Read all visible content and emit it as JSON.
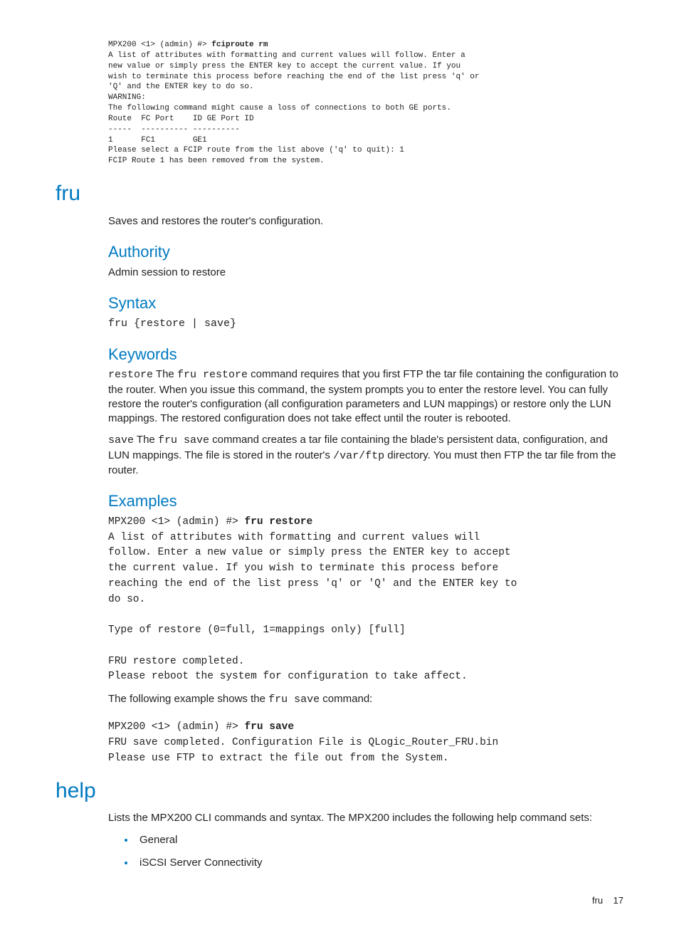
{
  "top_code": {
    "prompt": "MPX200 <1> (admin) #> ",
    "cmd": "fciproute rm",
    "body": "A list of attributes with formatting and current values will follow. Enter a\nnew value or simply press the ENTER key to accept the current value. If you\nwish to terminate this process before reaching the end of the list press 'q' or\n'Q' and the ENTER key to do so.\nWARNING:\nThe following command might cause a loss of connections to both GE ports.\nRoute  FC Port    ID GE Port ID\n-----  ---------- ----------\n1      FC1        GE1\nPlease select a FCIP route from the list above ('q' to quit): 1\nFCIP Route 1 has been removed from the system."
  },
  "fru": {
    "title": "fru",
    "desc": "Saves and restores the router's configuration.",
    "authority_h": "Authority",
    "authority_txt": "Admin session to restore",
    "syntax_h": "Syntax",
    "syntax_code": "fru {restore | save}",
    "keywords_h": "Keywords",
    "kw_restore_code": "restore",
    "kw_restore_txt_a": " The ",
    "kw_restore_cmd": "fru restore",
    "kw_restore_txt_b": " command requires that you first FTP the tar file containing the configuration to the router. When you issue this command, the system prompts you to enter the restore level. You can fully restore the router's configuration (all configuration parameters and LUN mappings) or restore only the LUN mappings. The restored configuration does not take effect until the router is rebooted.",
    "kw_save_code": "save",
    "kw_save_txt_a": " The ",
    "kw_save_cmd": "fru save",
    "kw_save_txt_b": " command creates a tar file containing the blade's persistent data, configuration, and LUN mappings. The file is stored in the router's ",
    "kw_save_path": "/var/ftp",
    "kw_save_txt_c": " directory. You must then FTP the tar file from the router.",
    "examples_h": "Examples",
    "ex1_prompt": "MPX200 <1> (admin) #> ",
    "ex1_cmd": "fru restore",
    "ex1_body": "\nA list of attributes with formatting and current values will\nfollow. Enter a new value or simply press the ENTER key to accept\nthe current value. If you wish to terminate this process before\nreaching the end of the list press 'q' or 'Q' and the ENTER key to\ndo so.\n\nType of restore (0=full, 1=mappings only) [full]\n\nFRU restore completed.\nPlease reboot the system for configuration to take affect.",
    "ex_between_a": "The following example shows the ",
    "ex_between_cmd": "fru save",
    "ex_between_b": " command:",
    "ex2_prompt": "MPX200 <1> (admin) #> ",
    "ex2_cmd": "fru save",
    "ex2_body": "\nFRU save completed. Configuration File is QLogic_Router_FRU.bin\nPlease use FTP to extract the file out from the System."
  },
  "help": {
    "title": "help",
    "desc": "Lists the MPX200 CLI commands and syntax. The MPX200 includes the following help command sets:",
    "items": [
      "General",
      "iSCSI Server Connectivity"
    ]
  },
  "footer": {
    "label": "fru",
    "page": "17"
  }
}
